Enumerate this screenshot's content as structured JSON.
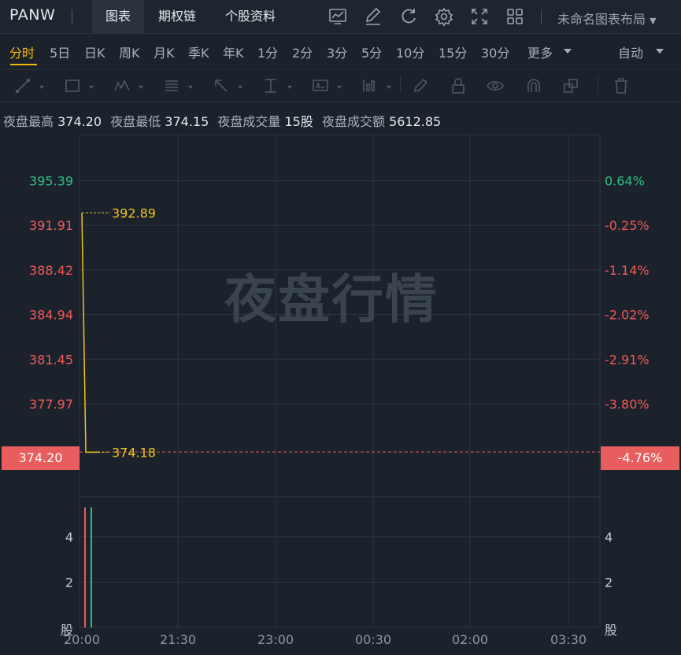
{
  "header": {
    "ticker": "PANW",
    "tabs": [
      "图表",
      "期权链",
      "个股资料"
    ],
    "active_tab": "图表",
    "layout_name": "未命名图表布局",
    "icons": [
      "indicator-icon",
      "draw-edit-icon",
      "refresh-icon",
      "settings-icon",
      "fullscreen-icon",
      "layout-grid-icon"
    ]
  },
  "periods": {
    "items": [
      "分时",
      "5日",
      "日K",
      "周K",
      "月K",
      "季K",
      "年K",
      "1分",
      "2分",
      "3分",
      "5分",
      "10分",
      "15分",
      "30分",
      "更多"
    ],
    "active": "分时",
    "auto_label": "自动"
  },
  "draw_tools": [
    "trend-line-icon",
    "rectangle-icon",
    "pattern-icon",
    "fib-icon",
    "arrow-icon",
    "measure-icon",
    "text-annotation-icon",
    "indicator-bar-icon",
    "pen-icon",
    "lock-icon",
    "eye-icon",
    "magnet-icon",
    "layers-icon",
    "trash-icon"
  ],
  "stats": [
    {
      "label": "夜盘最高",
      "value": "374.20"
    },
    {
      "label": "夜盘最低",
      "value": "374.15"
    },
    {
      "label": "夜盘成交量",
      "value": "15股"
    },
    {
      "label": "夜盘成交额",
      "value": "5612.85"
    }
  ],
  "watermark": "夜盘行情",
  "current": {
    "price": "374.20",
    "change_pct": "-4.76%"
  },
  "colors": {
    "up": "#2ebd85",
    "down": "#f05858",
    "line": "#f0c419",
    "bg": "#1b222c"
  },
  "chart_data": {
    "type": "line",
    "price_ticks": [
      "395.39",
      "391.91",
      "388.42",
      "384.94",
      "381.45",
      "377.97"
    ],
    "pct_ticks": [
      "0.64%",
      "-0.25%",
      "-1.14%",
      "-2.02%",
      "-2.91%",
      "-3.80%"
    ],
    "price_ylim": [
      370.7,
      399.0
    ],
    "x_ticks": [
      "20:00",
      "21:30",
      "23:00",
      "00:30",
      "02:00",
      "03:30"
    ],
    "series": [
      {
        "x": [
          "20:00",
          "20:01"
        ],
        "values": [
          392.89,
          374.18
        ]
      }
    ],
    "annotations": [
      {
        "label": "392.89",
        "value": 392.89
      },
      {
        "label": "374.18",
        "value": 374.18
      }
    ],
    "volume": {
      "ticks": [
        "4",
        "2"
      ],
      "unit": "股",
      "ylim": [
        0,
        5.7
      ],
      "bars": [
        {
          "x": "20:00",
          "value": 5.3,
          "color": "#f05858"
        },
        {
          "x": "20:01",
          "value": 5.3,
          "color": "#2ebd85"
        }
      ]
    }
  }
}
